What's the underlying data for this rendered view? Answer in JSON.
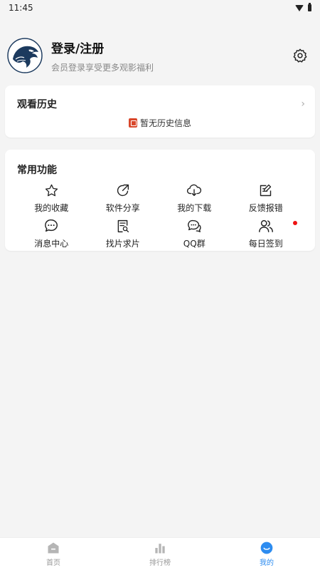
{
  "status_bar": {
    "time": "11:45"
  },
  "profile": {
    "title": "登录/注册",
    "subtitle": "会员登录享受更多观影福利"
  },
  "history": {
    "title": "观看历史",
    "empty_text": "暂无历史信息"
  },
  "functions": {
    "title": "常用功能",
    "items": [
      {
        "label": "我的收藏",
        "icon": "star-icon"
      },
      {
        "label": "软件分享",
        "icon": "share-icon"
      },
      {
        "label": "我的下载",
        "icon": "cloud-download-icon"
      },
      {
        "label": "反馈报错",
        "icon": "edit-icon"
      },
      {
        "label": "消息中心",
        "icon": "message-icon"
      },
      {
        "label": "找片求片",
        "icon": "search-doc-icon"
      },
      {
        "label": "QQ群",
        "icon": "chat-bubbles-icon"
      },
      {
        "label": "每日签到",
        "icon": "users-icon",
        "badge": true
      }
    ]
  },
  "tabbar": {
    "active_color": "#2d8cf0",
    "tabs": [
      {
        "label": "首页",
        "icon": "home-icon"
      },
      {
        "label": "排行榜",
        "icon": "bar-chart-icon"
      },
      {
        "label": "我的",
        "icon": "smile-icon",
        "active": true
      }
    ]
  }
}
